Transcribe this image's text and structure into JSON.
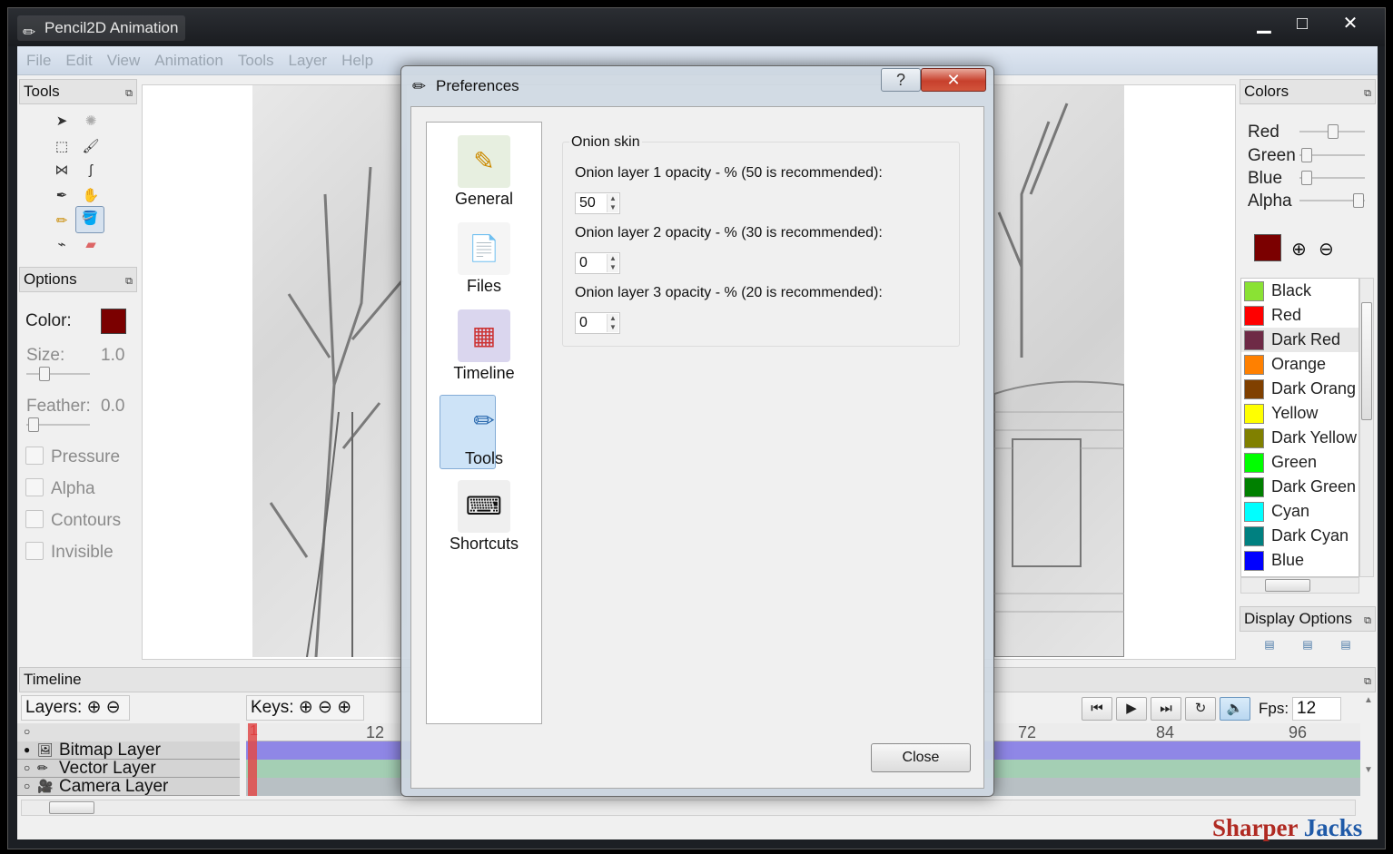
{
  "app": {
    "title": "Pencil2D Animation"
  },
  "window_controls": {
    "minimize": "▁",
    "maximize": "□",
    "close": "✕"
  },
  "menu": [
    "File",
    "Edit",
    "View",
    "Animation",
    "Tools",
    "Layer",
    "Help"
  ],
  "tools_panel": {
    "title": "Tools",
    "float": "⧉"
  },
  "options_panel": {
    "title": "Options",
    "color_label": "Color:",
    "color_value": "#7b0000",
    "size_label": "Size:",
    "size_value": "1.0",
    "feather_label": "Feather:",
    "feather_value": "0.0",
    "checkboxes": [
      "Pressure",
      "Alpha",
      "Contours",
      "Invisible"
    ]
  },
  "colors_panel": {
    "title": "Colors",
    "sliders": [
      "Red",
      "Green",
      "Blue",
      "Alpha"
    ],
    "current_color": "#7b0000",
    "add": "⊕",
    "remove": "⊖",
    "palette": [
      {
        "name": "Black",
        "hex": "#8ae234"
      },
      {
        "name": "Red",
        "hex": "#ff0000"
      },
      {
        "name": "Dark Red",
        "hex": "#6e2a46"
      },
      {
        "name": "Orange",
        "hex": "#ff8000"
      },
      {
        "name": "Dark Orang",
        "hex": "#804000"
      },
      {
        "name": "Yellow",
        "hex": "#ffff00"
      },
      {
        "name": "Dark Yellow",
        "hex": "#808000"
      },
      {
        "name": "Green",
        "hex": "#00ff00"
      },
      {
        "name": "Dark Green",
        "hex": "#008000"
      },
      {
        "name": "Cyan",
        "hex": "#00ffff"
      },
      {
        "name": "Dark Cyan",
        "hex": "#008080"
      },
      {
        "name": "Blue",
        "hex": "#0000ff"
      }
    ]
  },
  "display_options": {
    "title": "Display Options"
  },
  "timeline": {
    "title": "Timeline",
    "layers_label": "Layers:",
    "keys_label": "Keys:",
    "fps_label": "Fps:",
    "fps_value": "12",
    "ruler_left": [
      "1",
      "12"
    ],
    "ruler_right": [
      "72",
      "84",
      "96"
    ],
    "layers": [
      {
        "name": "Bitmap Layer",
        "color": "#8f87e6"
      },
      {
        "name": "Vector Layer",
        "color": "#a4cfb4"
      },
      {
        "name": "Camera Layer",
        "color": "#b8c0c4"
      }
    ],
    "playback": [
      "⏮",
      "▶",
      "⏭",
      "↻",
      "🔈"
    ]
  },
  "dialog": {
    "title": "Preferences",
    "help": "?",
    "close_x": "✕",
    "nav": [
      {
        "label": "General",
        "icon": "✎"
      },
      {
        "label": "Files",
        "icon": "📄"
      },
      {
        "label": "Timeline",
        "icon": "▦"
      },
      {
        "label": "Tools",
        "icon": "✏"
      },
      {
        "label": "Shortcuts",
        "icon": "⌨"
      }
    ],
    "group_title": "Onion skin",
    "fields": [
      {
        "label": "Onion layer 1 opacity - % (50 is recommended):",
        "value": "50"
      },
      {
        "label": "Onion layer 2 opacity - % (30 is recommended):",
        "value": "0"
      },
      {
        "label": "Onion layer 3 opacity - % (20 is recommended):",
        "value": "0"
      }
    ],
    "close_label": "Close"
  },
  "watermark": {
    "word1": "Sharper",
    "word2": "Jacks",
    "color1": "#b02a22",
    "color2": "#1f5aa8"
  }
}
